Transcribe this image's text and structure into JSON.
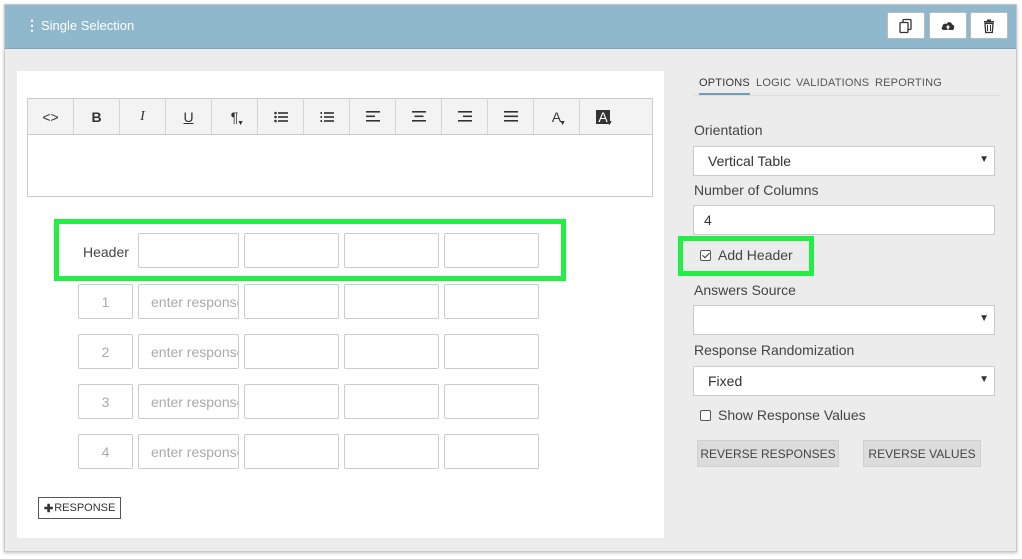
{
  "header": {
    "title": "Single Selection",
    "buttons": [
      {
        "name": "copy-button",
        "icon": "copy-icon"
      },
      {
        "name": "upload-button",
        "icon": "cloud-upload-icon"
      },
      {
        "name": "delete-button",
        "icon": "trash-icon"
      }
    ]
  },
  "toolbar": {
    "items": [
      {
        "name": "code-view",
        "label": "<>"
      },
      {
        "name": "bold",
        "label": "B"
      },
      {
        "name": "italic",
        "label": "I"
      },
      {
        "name": "underline",
        "label": "U"
      },
      {
        "name": "paragraph",
        "label": "¶"
      },
      {
        "name": "bullet-list",
        "label": ""
      },
      {
        "name": "numbered-list",
        "label": ""
      },
      {
        "name": "align-left",
        "label": ""
      },
      {
        "name": "align-center",
        "label": ""
      },
      {
        "name": "align-right",
        "label": ""
      },
      {
        "name": "justify",
        "label": ""
      },
      {
        "name": "font-color",
        "label": "A"
      },
      {
        "name": "highlight-color",
        "label": "A"
      }
    ]
  },
  "grid": {
    "header_label": "Header",
    "rows": [
      {
        "number": "1",
        "placeholder": "enter response"
      },
      {
        "number": "2",
        "placeholder": "enter response"
      },
      {
        "number": "3",
        "placeholder": "enter response"
      },
      {
        "number": "4",
        "placeholder": "enter response"
      }
    ],
    "add_response_label": "RESPONSE"
  },
  "options": {
    "tabs": [
      "OPTIONS",
      "LOGIC",
      "VALIDATIONS",
      "REPORTING"
    ],
    "active_tab": "OPTIONS",
    "orientation_label": "Orientation",
    "orientation_value": "Vertical Table",
    "columns_label": "Number of Columns",
    "columns_value": "4",
    "add_header_label": "Add Header",
    "add_header_checked": true,
    "answers_source_label": "Answers Source",
    "answers_source_value": "",
    "randomization_label": "Response Randomization",
    "randomization_value": "Fixed",
    "show_values_label": "Show Response Values",
    "show_values_checked": false,
    "reverse_responses_label": "REVERSE RESPONSES",
    "reverse_values_label": "REVERSE VALUES"
  },
  "colors": {
    "header_bar": "#8fb8cc",
    "highlight": "#22ee44"
  }
}
